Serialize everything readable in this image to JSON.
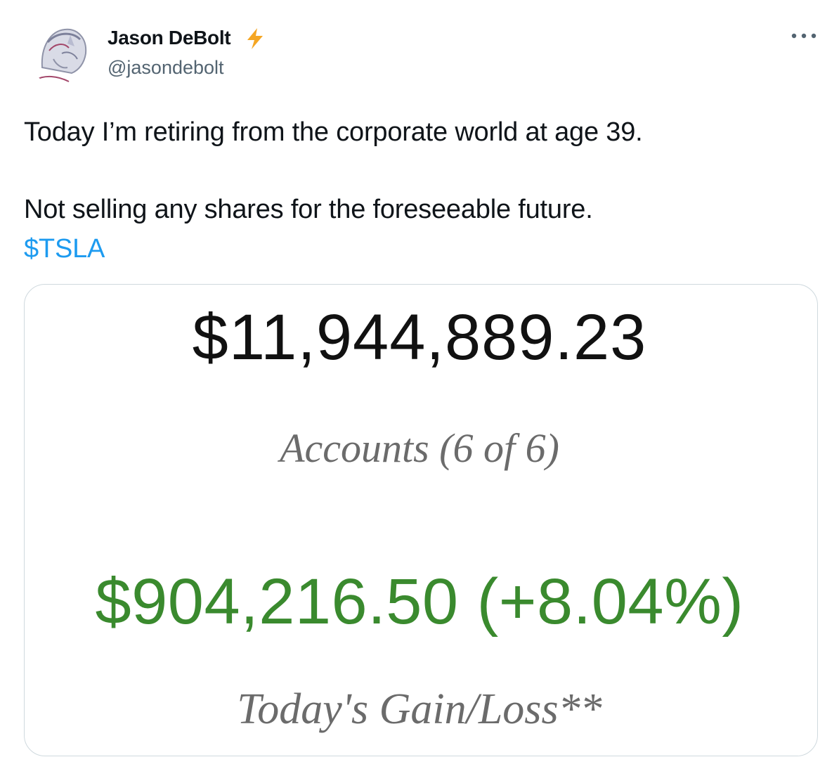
{
  "author": {
    "display_name": "Jason DeBolt",
    "handle": "@jasondebolt",
    "badge_icon": "lightning-bolt-icon",
    "badge_color": "#f5a623"
  },
  "tweet": {
    "line1": "Today I’m retiring from the corporate world at age 39.",
    "line2": "Not selling any shares for the foreseeable future.",
    "cashtag": "$TSLA"
  },
  "media": {
    "balance": "$11,944,889.23",
    "accounts_label": "Accounts (6 of 6)",
    "gain": "$904,216.50 (+8.04%)",
    "gain_label": "Today's Gain/Loss**",
    "gain_color": "#3a8a2e"
  },
  "colors": {
    "link": "#1d9bf0",
    "secondary_text": "#536471",
    "border": "#cfd9de"
  }
}
